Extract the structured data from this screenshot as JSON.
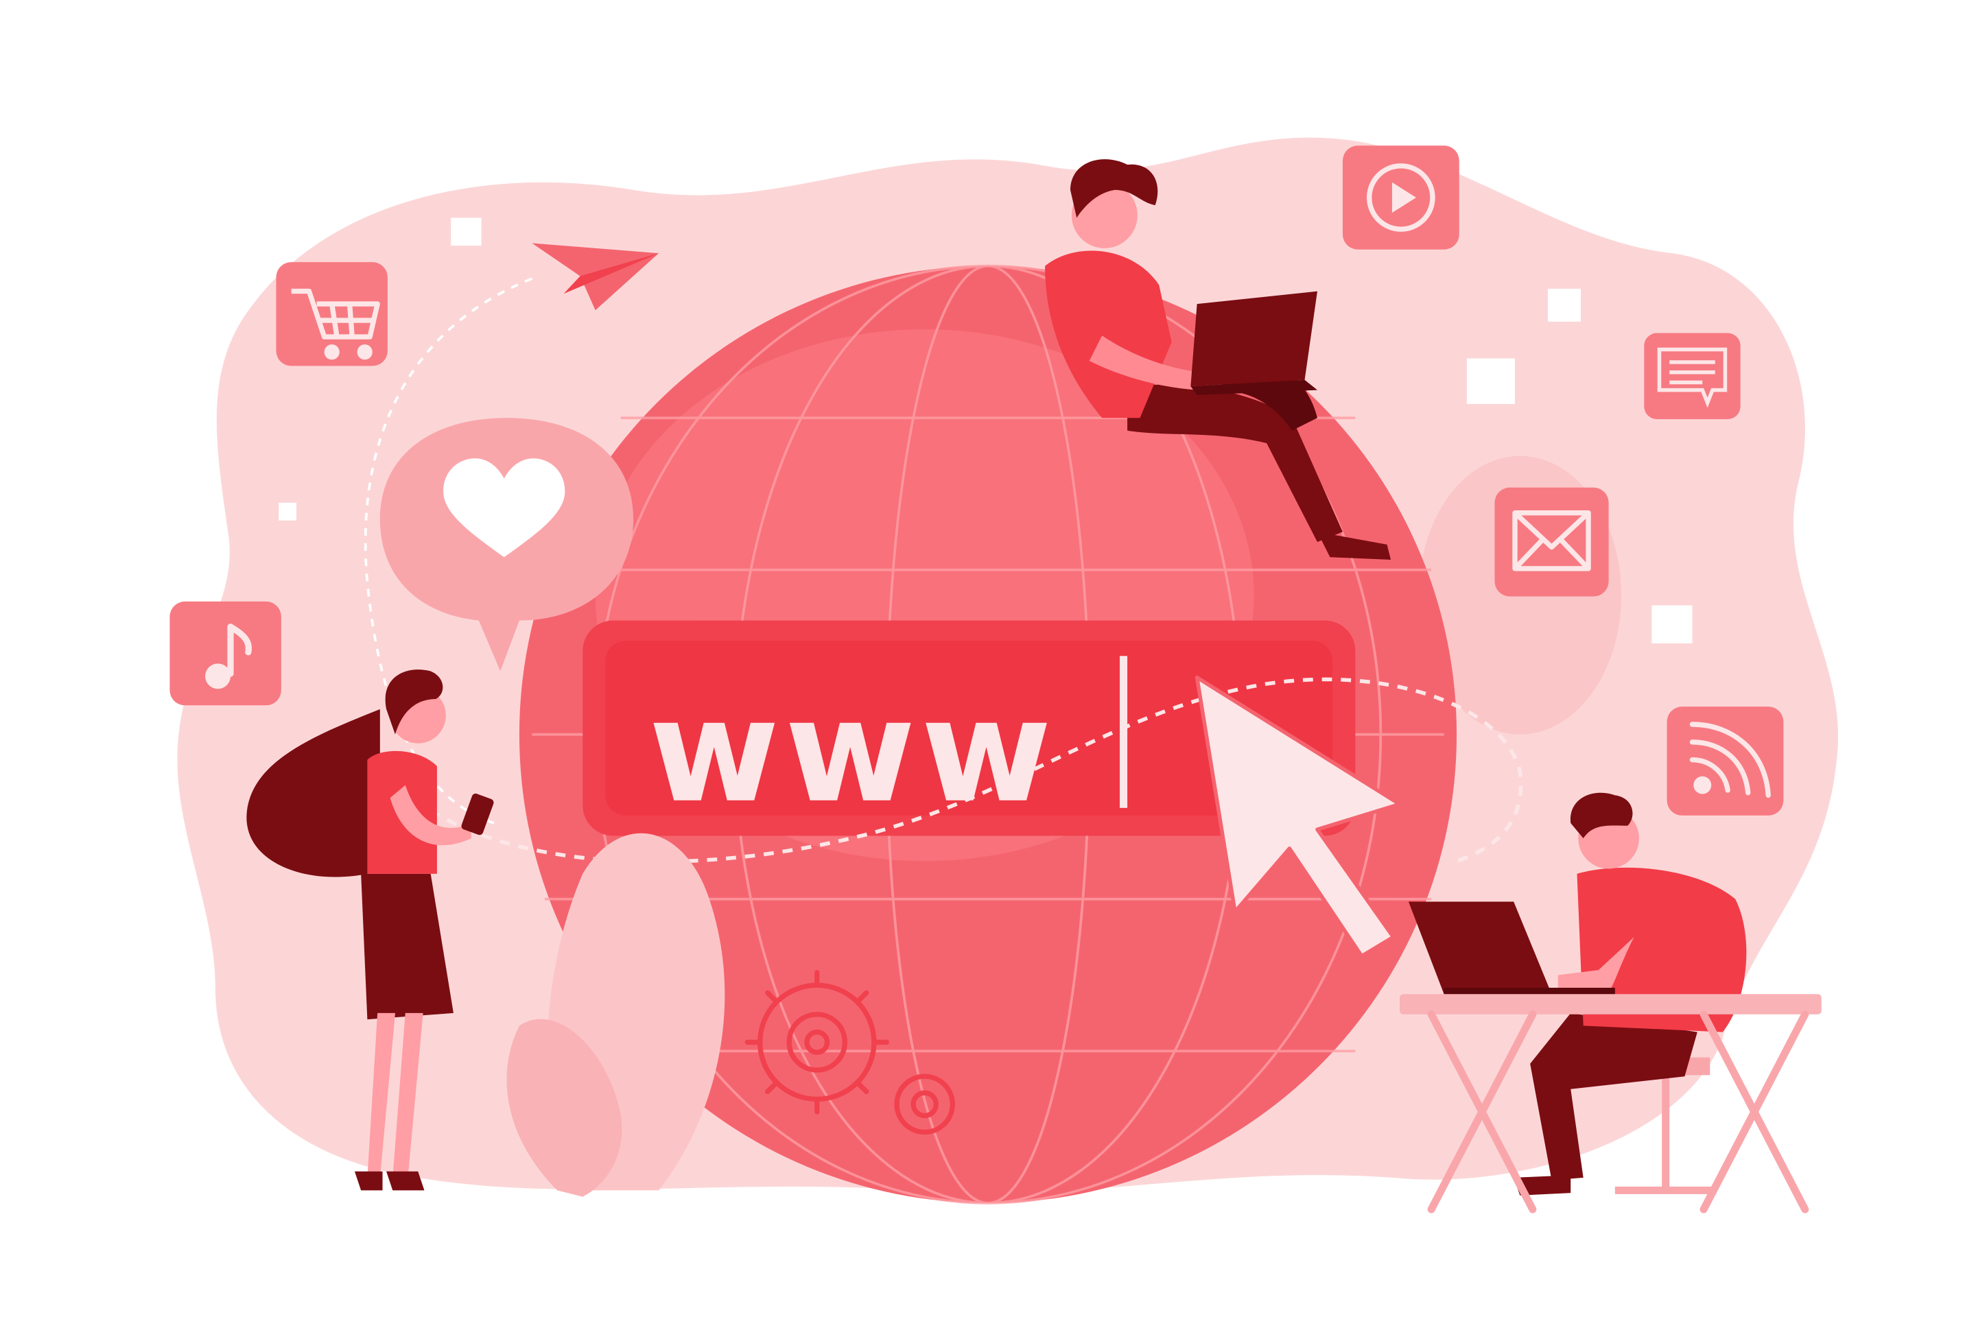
{
  "illustration": {
    "address_bar_text": "www"
  },
  "palette": {
    "blob": "#fcd6d7",
    "globe": "#f4646f",
    "globe_light": "#ff8a92",
    "bar": "#f1414e",
    "cursor": "#fde6e7",
    "dark": "#7a0d12",
    "accent": "#f23c48",
    "tile": "#f77a82"
  },
  "icons": [
    "shopping-cart-icon",
    "paper-plane-icon",
    "heart-chat-icon",
    "music-note-icon",
    "play-button-icon",
    "message-icon",
    "mail-icon",
    "wifi-signal-icon",
    "gear-icon"
  ]
}
